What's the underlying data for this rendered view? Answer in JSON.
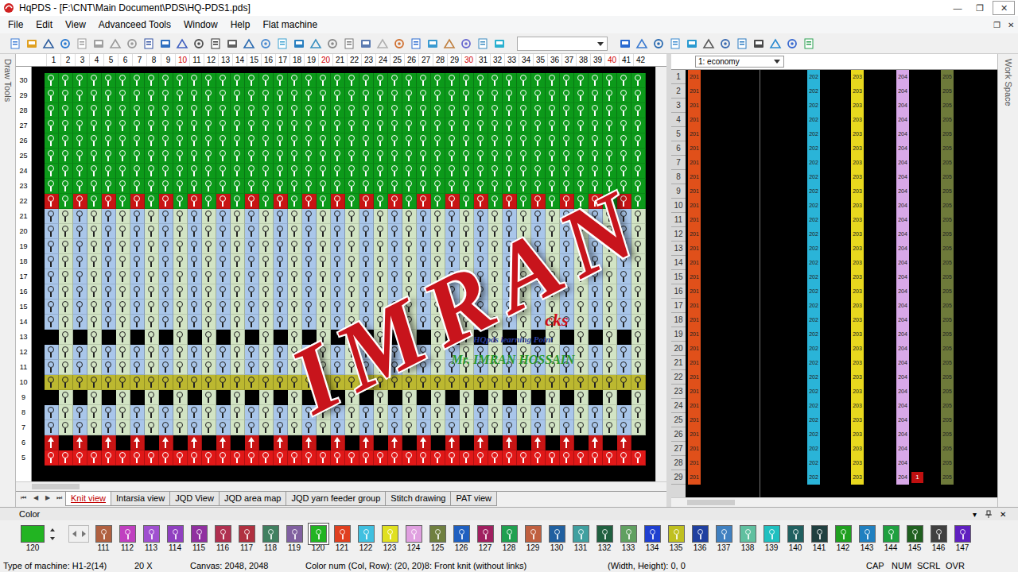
{
  "window": {
    "title": "HqPDS - [F:\\CNT\\Main Document\\PDS\\HQ-PDS1.pds]",
    "buttons": [
      "—",
      "❐",
      "✕"
    ]
  },
  "menu": {
    "items": [
      "File",
      "Edit",
      "View",
      "Advanceed Tools",
      "Window",
      "Help",
      "Flat machine"
    ],
    "mdi_buttons": [
      "❐",
      "✕"
    ]
  },
  "side_tabs": {
    "left": "Draw Tools",
    "right": "Work Space"
  },
  "canvas": {
    "columns": [
      {
        "n": "1",
        "major": false
      },
      {
        "n": "2",
        "major": false
      },
      {
        "n": "3",
        "major": false
      },
      {
        "n": "4",
        "major": false
      },
      {
        "n": "5",
        "major": false
      },
      {
        "n": "6",
        "major": false
      },
      {
        "n": "7",
        "major": false
      },
      {
        "n": "8",
        "major": false
      },
      {
        "n": "9",
        "major": false
      },
      {
        "n": "10",
        "major": true
      },
      {
        "n": "11",
        "major": false
      },
      {
        "n": "12",
        "major": false
      },
      {
        "n": "13",
        "major": false
      },
      {
        "n": "14",
        "major": false
      },
      {
        "n": "15",
        "major": false
      },
      {
        "n": "16",
        "major": false
      },
      {
        "n": "17",
        "major": false
      },
      {
        "n": "18",
        "major": false
      },
      {
        "n": "19",
        "major": false
      },
      {
        "n": "20",
        "major": true
      },
      {
        "n": "21",
        "major": false
      },
      {
        "n": "22",
        "major": false
      },
      {
        "n": "23",
        "major": false
      },
      {
        "n": "24",
        "major": false
      },
      {
        "n": "25",
        "major": false
      },
      {
        "n": "26",
        "major": false
      },
      {
        "n": "27",
        "major": false
      },
      {
        "n": "28",
        "major": false
      },
      {
        "n": "29",
        "major": false
      },
      {
        "n": "30",
        "major": true
      },
      {
        "n": "31",
        "major": false
      },
      {
        "n": "32",
        "major": false
      },
      {
        "n": "33",
        "major": false
      },
      {
        "n": "34",
        "major": false
      },
      {
        "n": "35",
        "major": false
      },
      {
        "n": "36",
        "major": false
      },
      {
        "n": "37",
        "major": false
      },
      {
        "n": "38",
        "major": false
      },
      {
        "n": "39",
        "major": false
      },
      {
        "n": "40",
        "major": true
      },
      {
        "n": "41",
        "major": false
      },
      {
        "n": "42",
        "major": false
      }
    ],
    "rows": [
      {
        "number": "30",
        "kind": "loop",
        "color": "#0c9a1a",
        "alt": "#0c9a1a"
      },
      {
        "number": "29",
        "kind": "loop",
        "color": "#0c9a1a",
        "alt": "#0c9a1a"
      },
      {
        "number": "28",
        "kind": "loop",
        "color": "#0c9a1a",
        "alt": "#0c9a1a"
      },
      {
        "number": "27",
        "kind": "loop",
        "color": "#0c9a1a",
        "alt": "#0c9a1a"
      },
      {
        "number": "26",
        "kind": "loop",
        "color": "#0c9a1a",
        "alt": "#0c9a1a"
      },
      {
        "number": "25",
        "kind": "loop",
        "color": "#0c9a1a",
        "alt": "#0c9a1a"
      },
      {
        "number": "24",
        "kind": "loop",
        "color": "#0c9a1a",
        "alt": "#0c9a1a"
      },
      {
        "number": "23",
        "kind": "loop",
        "color": "#0c9a1a",
        "alt": "#0c9a1a"
      },
      {
        "number": "22",
        "kind": "loop",
        "color": "#c81414",
        "alt": "#0c9a1a"
      },
      {
        "number": "21",
        "kind": "loop",
        "color": "#a9c6ea",
        "alt": "#d2e4c4"
      },
      {
        "number": "20",
        "kind": "loop",
        "color": "#a9c6ea",
        "alt": "#d2e4c4"
      },
      {
        "number": "19",
        "kind": "loop",
        "color": "#a9c6ea",
        "alt": "#d2e4c4"
      },
      {
        "number": "18",
        "kind": "loop",
        "color": "#a9c6ea",
        "alt": "#d2e4c4"
      },
      {
        "number": "17",
        "kind": "loop",
        "color": "#a9c6ea",
        "alt": "#d2e4c4"
      },
      {
        "number": "16",
        "kind": "loop",
        "color": "#a9c6ea",
        "alt": "#d2e4c4"
      },
      {
        "number": "15",
        "kind": "loop",
        "color": "#a9c6ea",
        "alt": "#d2e4c4"
      },
      {
        "number": "14",
        "kind": "loop",
        "color": "#a9c6ea",
        "alt": "#d2e4c4"
      },
      {
        "number": "13",
        "kind": "checker",
        "color": "#000000",
        "alt": "#d2e4c4"
      },
      {
        "number": "12",
        "kind": "loop",
        "color": "#a9c6ea",
        "alt": "#d2e4c4"
      },
      {
        "number": "11",
        "kind": "loop",
        "color": "#a9c6ea",
        "alt": "#d2e4c4"
      },
      {
        "number": "10",
        "kind": "loop",
        "color": "#bcb830",
        "alt": "#bcb830"
      },
      {
        "number": "9",
        "kind": "checker",
        "color": "#000000",
        "alt": "#d2e4c4"
      },
      {
        "number": "8",
        "kind": "loop",
        "color": "#a9c6ea",
        "alt": "#d2e4c4"
      },
      {
        "number": "7",
        "kind": "loop",
        "color": "#a9c6ea",
        "alt": "#d2e4c4"
      },
      {
        "number": "6",
        "kind": "arrow",
        "color": "#c81414",
        "alt": "#000000"
      },
      {
        "number": "5",
        "kind": "loop",
        "color": "#e01818",
        "alt": "#e01818"
      }
    ]
  },
  "view_tabs": {
    "nav": [
      "⏮",
      "◀",
      "▶",
      "⏭"
    ],
    "items": [
      {
        "label": "Knit view",
        "selected": true
      },
      {
        "label": "Intarsia view",
        "selected": false
      },
      {
        "label": "JQD View",
        "selected": false
      },
      {
        "label": "JQD area map",
        "selected": false
      },
      {
        "label": "JQD yarn feeder group",
        "selected": false
      },
      {
        "label": "Stitch drawing",
        "selected": false
      },
      {
        "label": "PAT view",
        "selected": false
      }
    ]
  },
  "yarn_panel": {
    "mode": "1: economy",
    "rows": [
      "1",
      "2",
      "3",
      "4",
      "5",
      "6",
      "7",
      "8",
      "9",
      "10",
      "11",
      "12",
      "13",
      "14",
      "15",
      "16",
      "17",
      "18",
      "19",
      "20",
      "21",
      "22",
      "23",
      "24",
      "25",
      "26",
      "27",
      "28",
      "29"
    ],
    "columns": [
      {
        "label": "201",
        "color": "#e0501a"
      },
      {
        "label": "202",
        "color": "#2ab4d8"
      },
      {
        "label": "203",
        "color": "#e8d81e"
      },
      {
        "label": "204",
        "color": "#d8a8e8",
        "mark": {
          "row": "29",
          "label": "1",
          "color": "#c01010"
        }
      },
      {
        "label": "205",
        "color": "#6e7a3a"
      }
    ]
  },
  "palette": {
    "title": "Color",
    "controls": [
      "▾",
      "✕"
    ],
    "current": {
      "label": "120",
      "color": "#22b422"
    },
    "swatches": [
      {
        "label": "111",
        "color": "#b06040",
        "selected": false
      },
      {
        "label": "112",
        "color": "#c040c0",
        "selected": false
      },
      {
        "label": "113",
        "color": "#a050d0",
        "selected": false
      },
      {
        "label": "114",
        "color": "#9040c0",
        "selected": false
      },
      {
        "label": "115",
        "color": "#9030a0",
        "selected": false
      },
      {
        "label": "116",
        "color": "#b03050",
        "selected": false
      },
      {
        "label": "117",
        "color": "#b03040",
        "selected": false
      },
      {
        "label": "118",
        "color": "#408060",
        "selected": false
      },
      {
        "label": "119",
        "color": "#8060a0",
        "selected": false
      },
      {
        "label": "120",
        "color": "#22b422",
        "selected": true
      },
      {
        "label": "121",
        "color": "#e04020",
        "selected": false
      },
      {
        "label": "122",
        "color": "#40c0e0",
        "selected": false
      },
      {
        "label": "123",
        "color": "#e0e020",
        "selected": false
      },
      {
        "label": "124",
        "color": "#e0a0e0",
        "selected": false
      },
      {
        "label": "125",
        "color": "#708040",
        "selected": false
      },
      {
        "label": "126",
        "color": "#2060c0",
        "selected": false
      },
      {
        "label": "127",
        "color": "#a02060",
        "selected": false
      },
      {
        "label": "128",
        "color": "#20a050",
        "selected": false
      },
      {
        "label": "129",
        "color": "#c06040",
        "selected": false
      },
      {
        "label": "130",
        "color": "#2060a0",
        "selected": false
      },
      {
        "label": "131",
        "color": "#40a0a0",
        "selected": false
      },
      {
        "label": "132",
        "color": "#206040",
        "selected": false
      },
      {
        "label": "133",
        "color": "#60a060",
        "selected": false
      },
      {
        "label": "134",
        "color": "#2040d0",
        "selected": false
      },
      {
        "label": "135",
        "color": "#c0c020",
        "selected": false
      },
      {
        "label": "136",
        "color": "#2040a0",
        "selected": false
      },
      {
        "label": "137",
        "color": "#4080c0",
        "selected": false
      },
      {
        "label": "138",
        "color": "#60c0a0",
        "selected": false
      },
      {
        "label": "139",
        "color": "#20c0c0",
        "selected": false
      },
      {
        "label": "140",
        "color": "#206060",
        "selected": false
      },
      {
        "label": "141",
        "color": "#204040",
        "selected": false
      },
      {
        "label": "142",
        "color": "#20a020",
        "selected": false
      },
      {
        "label": "143",
        "color": "#2080c0",
        "selected": false
      },
      {
        "label": "144",
        "color": "#20a040",
        "selected": false
      },
      {
        "label": "145",
        "color": "#206020",
        "selected": false
      },
      {
        "label": "146",
        "color": "#404040",
        "selected": false
      },
      {
        "label": "147",
        "color": "#6020c0",
        "selected": false
      }
    ]
  },
  "watermark": {
    "title": "IMRAN",
    "lines": [
      "cks",
      "HQpds learning Point",
      "Mr. IMRAN HOSSAIN"
    ]
  },
  "status_bar": [
    "Type of machine: H1-2(14)",
    "20 X",
    "Canvas: 2048, 2048",
    "Color num (Col, Row): (20, 20)8: Front knit (without links)",
    "(Width, Height): 0, 0",
    "CAP",
    "NUM",
    "SCRL",
    "OVR"
  ]
}
